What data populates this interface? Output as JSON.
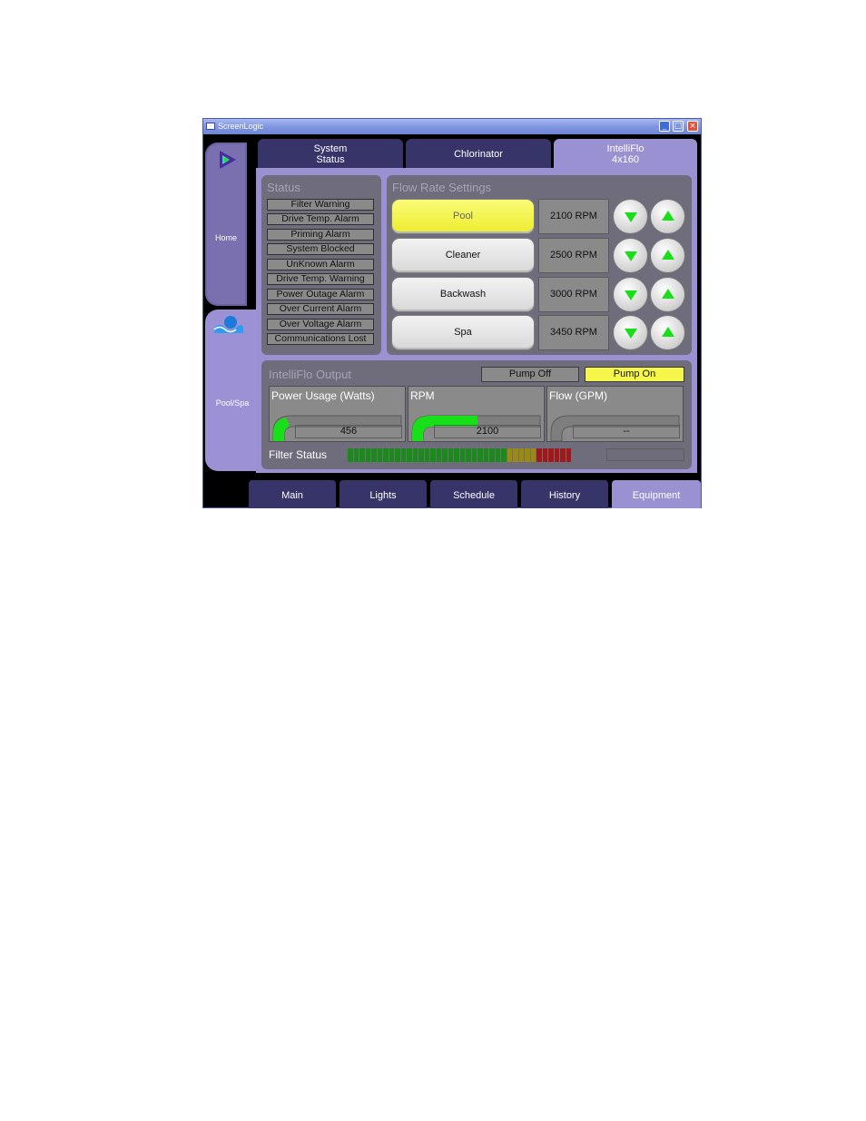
{
  "window": {
    "title": "ScreenLogic"
  },
  "side_tabs": [
    {
      "label": "Home"
    },
    {
      "label": "Pool/Spa"
    }
  ],
  "top_tabs": [
    {
      "label_line1": "System",
      "label_line2": "Status"
    },
    {
      "label_line1": "Chlorinator",
      "label_line2": ""
    },
    {
      "label_line1": "IntelliFlo",
      "label_line2": "4x160"
    }
  ],
  "status": {
    "title": "Status",
    "items": [
      "Filter Warning",
      "Drive Temp. Alarm",
      "Priming Alarm",
      "System Blocked",
      "UnKnown Alarm",
      "Drive Temp. Warning",
      "Power Outage Alarm",
      "Over Current Alarm",
      "Over Voltage Alarm",
      "Communications Lost"
    ]
  },
  "flow_rate": {
    "title": "Flow Rate Settings",
    "rows": [
      {
        "name": "Pool",
        "rpm": "2100 RPM"
      },
      {
        "name": "Cleaner",
        "rpm": "2500 RPM"
      },
      {
        "name": "Backwash",
        "rpm": "3000 RPM"
      },
      {
        "name": "Spa",
        "rpm": "3450 RPM"
      }
    ]
  },
  "output": {
    "title": "IntelliFlo Output",
    "pump_off": "Pump Off",
    "pump_on": "Pump On",
    "gauges": [
      {
        "label": "Power Usage (Watts)",
        "value": "456"
      },
      {
        "label": "RPM",
        "value": "2100"
      },
      {
        "label": "Flow (GPM)",
        "value": "--"
      }
    ],
    "filter_status_label": "Filter Status"
  },
  "bottom_tabs": [
    "Main",
    "Lights",
    "Schedule",
    "History",
    "Equipment"
  ],
  "colors": {
    "accent_green": "#18e018",
    "selected_yellow": "#f6f64a",
    "tab_dark": "#37346a",
    "panel_purple": "#9a91d2"
  }
}
